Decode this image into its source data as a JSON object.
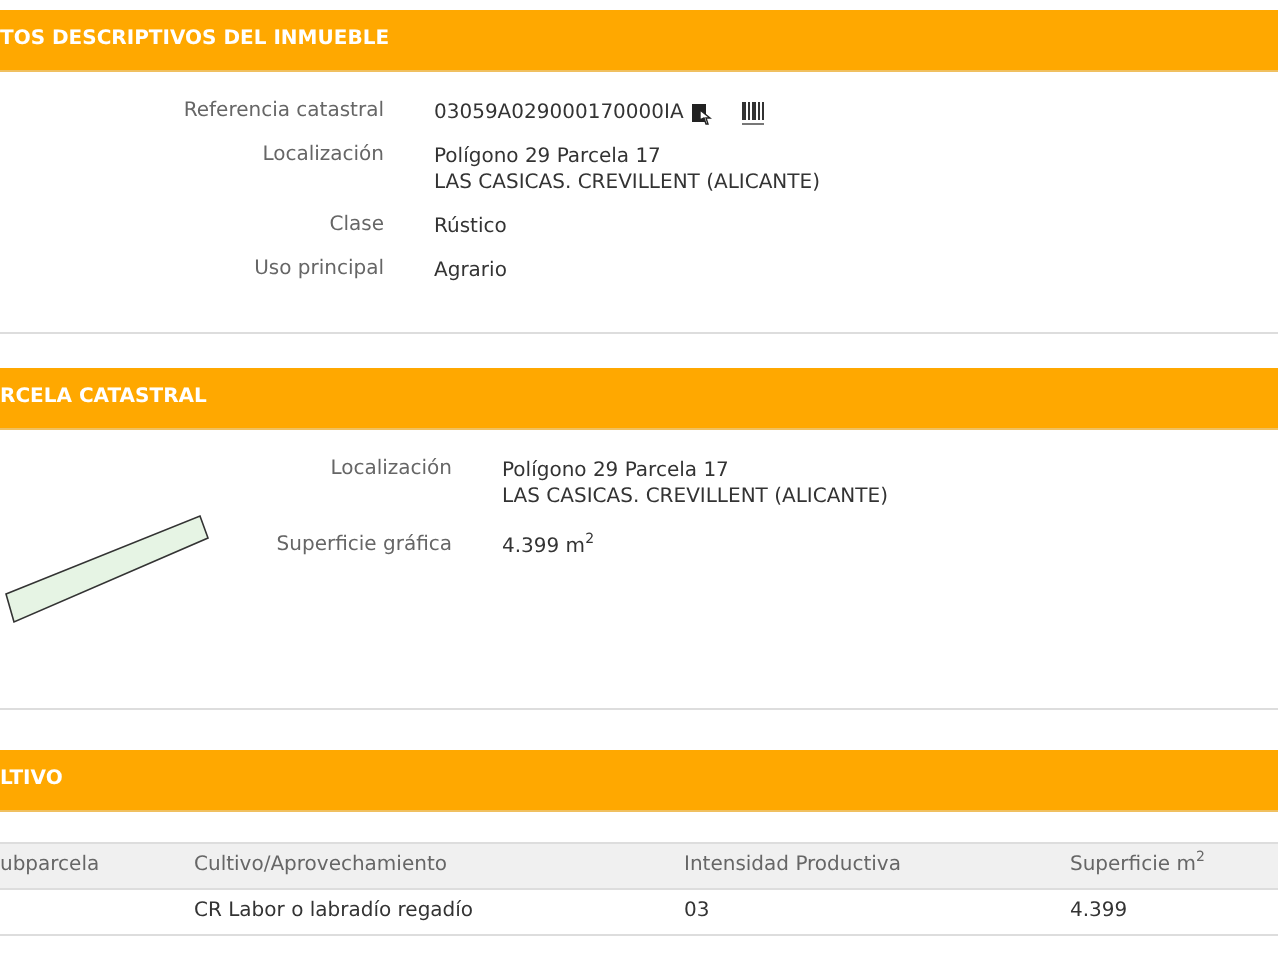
{
  "sections": [
    {
      "title": "TOS DESCRIPTIVOS DEL INMUEBLE",
      "kind": "fields",
      "fields": [
        {
          "label": "Referencia catastral",
          "lines": [
            "03059A029000170000IA"
          ],
          "icons": true
        },
        {
          "label": "Localización",
          "lines": [
            "Polígono 29 Parcela 17",
            "LAS CASICAS. CREVILLENT (ALICANTE)"
          ]
        },
        {
          "label": "Clase",
          "lines": [
            "Rústico"
          ]
        },
        {
          "label": "Uso principal",
          "lines": [
            "Agrario"
          ]
        }
      ]
    },
    {
      "title": "RCELA CATASTRAL",
      "kind": "parcel",
      "fields": [
        {
          "label": "Localización",
          "lines": [
            "Polígono 29 Parcela 17",
            "LAS CASICAS. CREVILLENT (ALICANTE)"
          ]
        },
        {
          "label": "Superficie gráfica",
          "lines": [
            "4.399 m$^{2}$"
          ]
        }
      ]
    },
    {
      "title": "LTIVO",
      "kind": "table",
      "columns": [
        "ubparcela",
        "Cultivo/Aprovechamiento",
        "Intensidad Productiva",
        "Superficie m$^{2}$"
      ],
      "rows": [
        [
          "",
          "CR Labor o labradío regadío",
          "03",
          "4.399"
        ]
      ]
    }
  ]
}
